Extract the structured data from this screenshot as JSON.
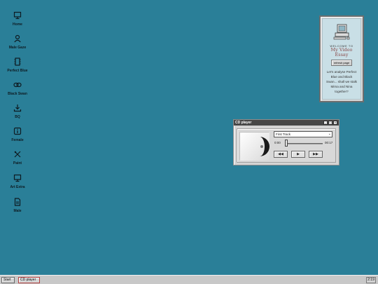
{
  "desktop_icons": [
    {
      "label": "Home",
      "icon": "monitor-icon"
    },
    {
      "label": "Male Gaze",
      "icon": "user-icon"
    },
    {
      "label": "Perfect Blue",
      "icon": "film-icon"
    },
    {
      "label": "Black Swan",
      "icon": "link-icon"
    },
    {
      "label": "BQ",
      "icon": "download-icon"
    },
    {
      "label": "Female",
      "icon": "info-icon"
    },
    {
      "label": "Paint",
      "icon": "paint-tools-icon"
    },
    {
      "label": "Art Extra",
      "icon": "monitor-icon"
    },
    {
      "label": "Male",
      "icon": "document-icon"
    }
  ],
  "welcome": {
    "small": "WELCOME TO",
    "title_line1": "My Video",
    "title_line2": "Essay",
    "refresh_label": "refresh page",
    "body_line1": "Let's analyse Perfect",
    "body_line2": "Blue and Black",
    "body_line3": "Swan... shall we stalk",
    "body_line4": "Mima and Nina",
    "body_line5": "together?",
    "icon": "computer-icon"
  },
  "cd_player": {
    "title": "CD player",
    "track": "First Track",
    "time_current": "0:00",
    "time_total": "00:17",
    "progress_fraction": 0,
    "buttons": [
      "◀◀",
      "▶",
      "▶▶"
    ]
  },
  "taskbar": {
    "start_label": "Start",
    "cd_label": "CD player",
    "clock": "2:19"
  },
  "colors": {
    "desktop": "#2a7f98",
    "taskbar": "#c8c8c8"
  }
}
